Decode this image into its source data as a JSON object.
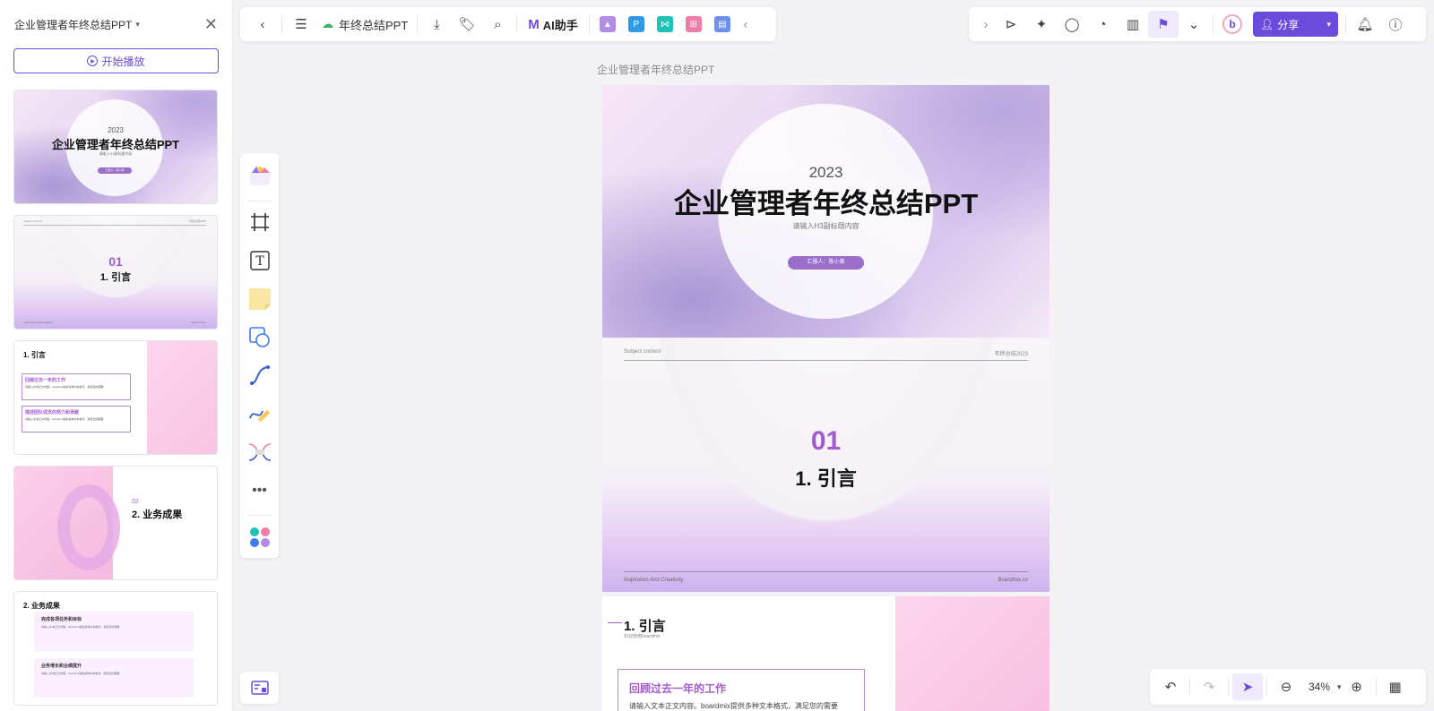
{
  "sidebar": {
    "title": "企业管理者年终总结PPT",
    "play_label": "开始播放",
    "thumbs": [
      {
        "year": "2023",
        "title": "企业管理者年终总结PPT",
        "sub": "请输入H3副标题内容",
        "pill": "汇报人：陈小黄"
      },
      {
        "num": "01",
        "title": "1. 引言",
        "top_left": "Subject content",
        "top_right": "年终总结2023",
        "bottom_left": "Inspiration And Creativity",
        "bottom_right": "Boardmix.cn"
      },
      {
        "heading": "1. 引言",
        "box1_title": "回顾过去一年的工作",
        "box1_text": "请输入文本正文内容。boardmix提供多种文本格式，满足您的需要",
        "box2_title": "描述团队成员的努力和贡献",
        "box2_text": "请输入文本正文内容。boardmix提供多种文本格式，满足您的需要"
      },
      {
        "num": "02",
        "title": "2. 业务成果"
      },
      {
        "heading": "2. 业务成果",
        "item1": "完成各项任务和目标",
        "item1_text": "请输入文本正文内容。boardmix提供多种文本格式，满足您的需要",
        "item2": "业务增长和业绩提升",
        "item2_text": "请输入文本正文内容。boardmix提供多种文本格式，满足您的需要"
      }
    ]
  },
  "toolbar": {
    "doc_name": "年终总结PPT",
    "ai_label": "AI助手",
    "share_label": "分享",
    "avatar_letter": "b"
  },
  "canvas": {
    "title": "企业管理者年终总结PPT",
    "slide1": {
      "year": "2023",
      "title": "企业管理者年终总结PPT",
      "subtitle": "请输入H3副标题内容",
      "pill": "汇报人：陈小黄"
    },
    "slide2": {
      "top_left": "Subject content",
      "top_right": "年终总结2023",
      "num": "01",
      "title": "1. 引言",
      "bottom_left": "Inspiration And Creativity",
      "bottom_right": "Boardmix.cn"
    },
    "slide3": {
      "heading": "1. 引言",
      "sub": "欢迎使用boardmix",
      "box_title": "回顾过去一年的工作",
      "box_text": "请输入文本正文内容。boardmix提供多种文本格式，满足您的需要"
    }
  },
  "zoom": {
    "value": "34%"
  },
  "colors": {
    "accent": "#6b4bdc",
    "purple_text": "#a35bd0",
    "pill": "#9b6fc9"
  }
}
